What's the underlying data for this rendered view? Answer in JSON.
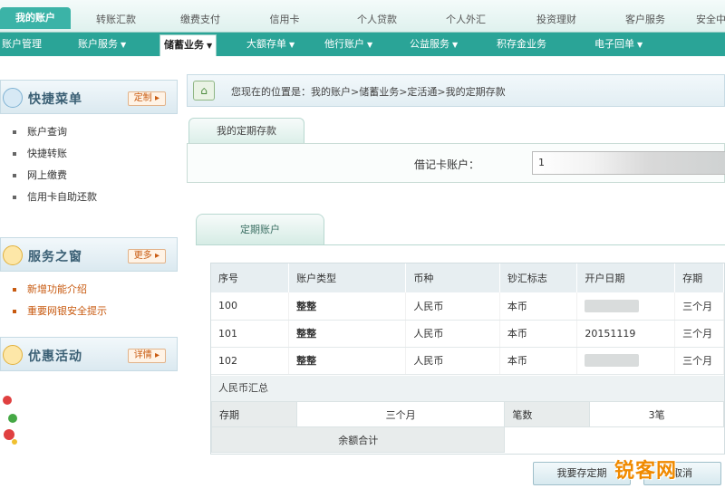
{
  "topnav": {
    "tabs": [
      "我的账户",
      "转账汇款",
      "缴费支付",
      "信用卡",
      "个人贷款",
      "个人外汇",
      "投资理财",
      "客户服务",
      "安全中心"
    ]
  },
  "subnav": {
    "items": [
      "账户管理",
      "账户服务",
      "储蓄业务",
      "大额存单",
      "他行账户",
      "公益服务",
      "积存金业务",
      "电子回单"
    ]
  },
  "sidebar": {
    "quick_menu": {
      "title": "快捷菜单",
      "action": "定制"
    },
    "quick_links": [
      "账户查询",
      "快捷转账",
      "网上缴费",
      "信用卡自助还款"
    ],
    "service": {
      "title": "服务之窗",
      "action": "更多"
    },
    "service_links": [
      "新增功能介绍",
      "重要网银安全提示"
    ],
    "promo": {
      "title": "优惠活动",
      "action": "详情"
    }
  },
  "breadcrumb": "您现在的位置是：我的账户>储蓄业务>定活通>我的定期存款",
  "section_tab": "我的定期存款",
  "account": {
    "label": "借记卡账户：",
    "value": "1"
  },
  "deposit_tab": "定期账户",
  "table": {
    "headers": [
      "序号",
      "账户类型",
      "币种",
      "钞汇标志",
      "开户日期",
      "存期"
    ],
    "rows": [
      {
        "no": "100",
        "type": "整整",
        "currency": "人民币",
        "flag": "本币",
        "date": "",
        "term": "三个月"
      },
      {
        "no": "101",
        "type": "整整",
        "currency": "人民币",
        "flag": "本币",
        "date": "20151119",
        "term": "三个月"
      },
      {
        "no": "102",
        "type": "整整",
        "currency": "人民币",
        "flag": "本币",
        "date": "",
        "term": "三个月"
      }
    ]
  },
  "summary": {
    "title": "人民币汇总",
    "term_label": "存期",
    "term_value": "三个月",
    "count_label": "笔数",
    "count_value": "3笔",
    "total_label": "余额合计"
  },
  "buttons": {
    "primary": "我要存定期",
    "secondary": "取消"
  },
  "watermark": "锐客网",
  "colors": {
    "teal": "#2aa497",
    "teal_active": "#3bb3a7",
    "orange": "#c85a10"
  }
}
